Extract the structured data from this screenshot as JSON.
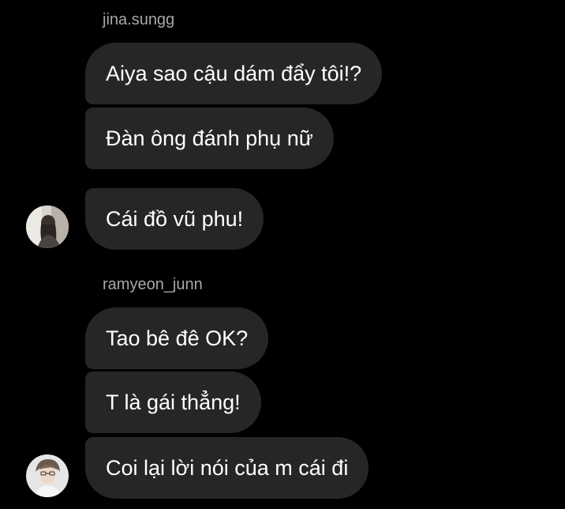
{
  "conversation": {
    "groups": [
      {
        "sender": "jina.sungg",
        "messages": [
          "Aiya sao cậu dám đẩy tôi!?",
          "Đàn ông đánh phụ nữ",
          "Cái đồ vũ phu!"
        ],
        "avatar": "profile-photo-woman-icon"
      },
      {
        "sender": "ramyeon_junn",
        "messages": [
          "Tao bê đê OK?",
          "T là gái thẳng!",
          "Coi lại lời nói của m cái đi"
        ],
        "avatar": "profile-photo-man-icon"
      }
    ]
  },
  "colors": {
    "background": "#000000",
    "bubble": "#262626",
    "message_text": "#ffffff",
    "sender_text": "#a8a8a8"
  }
}
